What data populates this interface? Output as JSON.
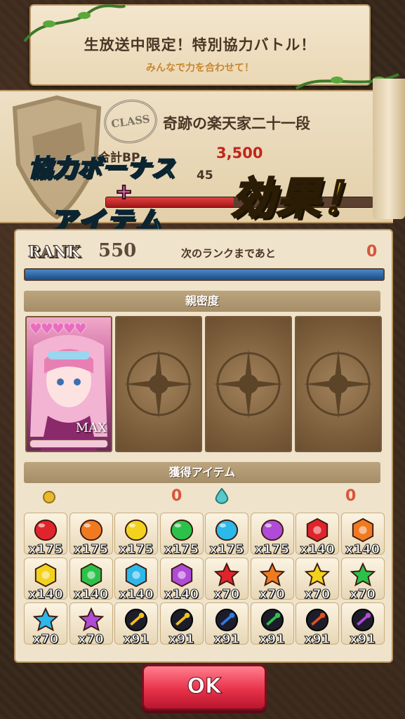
{
  "banner": {
    "title": "生放送中限定！特別協力バトル！",
    "subtitle": "みんなで力を合わせて！"
  },
  "class_card": {
    "stamp": "CLASS",
    "name": "奇跡の楽天家二十一段",
    "bp_label": "合計BP",
    "bp_value": "3,500",
    "bp_row2": "45"
  },
  "overlay": {
    "line1": "協力ボーナス",
    "plus": "+",
    "line2": "アイテム",
    "effect": "効果！"
  },
  "rank": {
    "label": "RANK",
    "value": "550",
    "next_label": "次のランクまであと",
    "next_value": "0",
    "progress": 1.0
  },
  "intimacy": {
    "header": "親密度",
    "hearts": "♥♥♥♥♥",
    "max_label": "MAX"
  },
  "items": {
    "header": "獲得アイテム",
    "currency1": "0",
    "currency2": "0",
    "gems": [
      {
        "color": "#e0242c",
        "shape": "round",
        "qty": "x175"
      },
      {
        "color": "#f07a20",
        "shape": "round",
        "qty": "x175"
      },
      {
        "color": "#f2d21c",
        "shape": "round",
        "qty": "x175"
      },
      {
        "color": "#2cc24a",
        "shape": "round",
        "qty": "x175"
      },
      {
        "color": "#2cb8e8",
        "shape": "round",
        "qty": "x175"
      },
      {
        "color": "#b04ad8",
        "shape": "round",
        "qty": "x175"
      },
      {
        "color": "#e0242c",
        "shape": "hex",
        "qty": "x140"
      },
      {
        "color": "#f07a20",
        "shape": "hex",
        "qty": "x140"
      },
      {
        "color": "#f2d21c",
        "shape": "hex",
        "qty": "x140"
      },
      {
        "color": "#2cc24a",
        "shape": "hex",
        "qty": "x140"
      },
      {
        "color": "#2cb8e8",
        "shape": "hex",
        "qty": "x140"
      },
      {
        "color": "#b04ad8",
        "shape": "hex",
        "qty": "x140"
      },
      {
        "color": "#e0242c",
        "shape": "star",
        "qty": "x70"
      },
      {
        "color": "#f07a20",
        "shape": "star",
        "qty": "x70"
      },
      {
        "color": "#f2d21c",
        "shape": "star",
        "qty": "x70"
      },
      {
        "color": "#2cc24a",
        "shape": "star",
        "qty": "x70"
      },
      {
        "color": "#2cb8e8",
        "shape": "star",
        "qty": "x70"
      },
      {
        "color": "#b04ad8",
        "shape": "star",
        "qty": "x70"
      },
      {
        "color": "#f0c020",
        "shape": "orb",
        "qty": "x91"
      },
      {
        "color": "#f0c020",
        "shape": "orb",
        "qty": "x91"
      },
      {
        "color": "#2c7ae8",
        "shape": "orb",
        "qty": "x91"
      },
      {
        "color": "#2cc24a",
        "shape": "orb",
        "qty": "x91"
      },
      {
        "color": "#e05020",
        "shape": "orb",
        "qty": "x91"
      },
      {
        "color": "#b04ad8",
        "shape": "orb",
        "qty": "x91"
      }
    ]
  },
  "ok_button": "OK"
}
